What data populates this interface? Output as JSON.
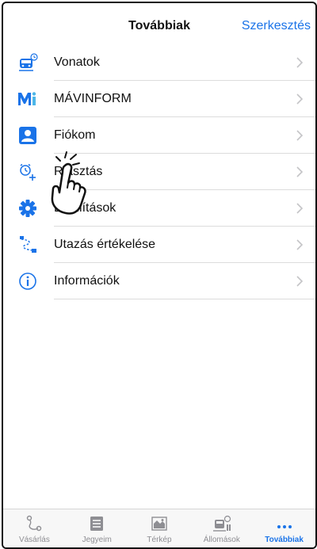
{
  "header": {
    "title": "Továbbiak",
    "edit_label": "Szerkesztés"
  },
  "menu": {
    "items": [
      {
        "label": "Vonatok",
        "icon": "train-icon"
      },
      {
        "label": "MÁVINFORM",
        "icon": "mavinform-icon"
      },
      {
        "label": "Fiókom",
        "icon": "account-icon"
      },
      {
        "label": "Riasztás",
        "icon": "alarm-add-icon"
      },
      {
        "label": "Beállítások",
        "icon": "gear-icon"
      },
      {
        "label": "Utazás értékelése",
        "icon": "route-rating-icon"
      },
      {
        "label": "Információk",
        "icon": "info-icon"
      }
    ]
  },
  "tabbar": {
    "tabs": [
      {
        "label": "Vásárlás",
        "icon": "route-icon",
        "active": false
      },
      {
        "label": "Jegyeim",
        "icon": "tickets-icon",
        "active": false
      },
      {
        "label": "Térkép",
        "icon": "map-icon",
        "active": false
      },
      {
        "label": "Állomások",
        "icon": "station-icon",
        "active": false
      },
      {
        "label": "Továbbiak",
        "icon": "more-icon",
        "active": true
      }
    ]
  },
  "colors": {
    "accent": "#1a73e8",
    "text": "#111111",
    "inactive": "#8e8e93",
    "separator": "#dcdcdc"
  }
}
